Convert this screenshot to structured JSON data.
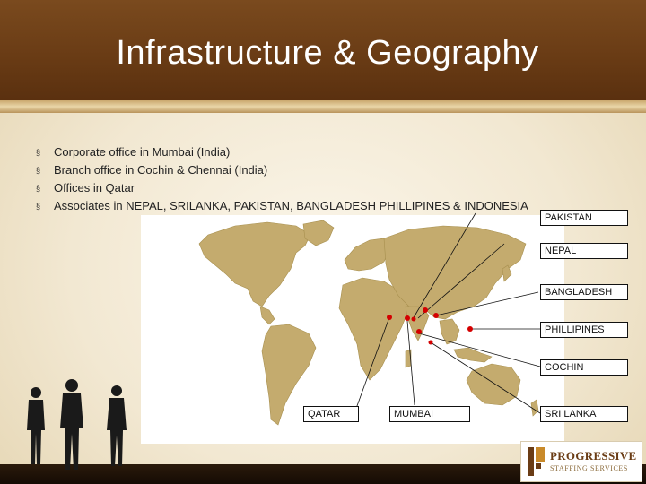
{
  "slide": {
    "title": "Infrastructure & Geography"
  },
  "bullets": [
    "Corporate office in Mumbai (India)",
    "Branch office in Cochin & Chennai (India)",
    "Offices in Qatar",
    "Associates in NEPAL, SRILANKA, PAKISTAN, BANGLADESH PHILLIPINES & INDONESIA"
  ],
  "bullet_marker": "§",
  "map_labels": {
    "pakistan": "PAKISTAN",
    "nepal": "NEPAL",
    "bangladesh": "BANGLADESH",
    "phillipines": "PHILLIPINES",
    "cochin": "COCHIN",
    "qatar": "QATAR",
    "mumbai": "MUMBAI",
    "sri_lanka": "SRI LANKA"
  },
  "logo": {
    "name": "PROGRESSIVE",
    "tagline": "STAFFING SERVICES"
  },
  "colors": {
    "header": "#6a3c15",
    "land": "#c4ab6e",
    "marker": "#d40000",
    "logo_text": "#6a3c15"
  }
}
